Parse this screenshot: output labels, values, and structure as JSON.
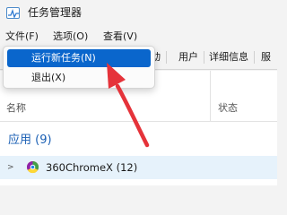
{
  "window": {
    "title": "任务管理器"
  },
  "menubar": {
    "items": [
      "文件(F)",
      "选项(O)",
      "查看(V)"
    ]
  },
  "file_menu": {
    "items": [
      "运行新任务(N)",
      "退出(X)"
    ],
    "highlighted": "运行新任务(N)"
  },
  "tabs": {
    "visible": [
      "动",
      "用户",
      "详细信息",
      "服"
    ]
  },
  "columns": {
    "name": "名称",
    "status": "状态"
  },
  "groups": {
    "apps": "应用 (9)"
  },
  "rows": [
    {
      "chevron": ">",
      "label": "360ChromeX (12)",
      "icon": "360chrome-icon"
    }
  ],
  "colors": {
    "highlight": "#0a66cc",
    "group_text": "#1a5fb4",
    "selected_row": "#e6f2fb",
    "annotation": "#e5333a"
  }
}
